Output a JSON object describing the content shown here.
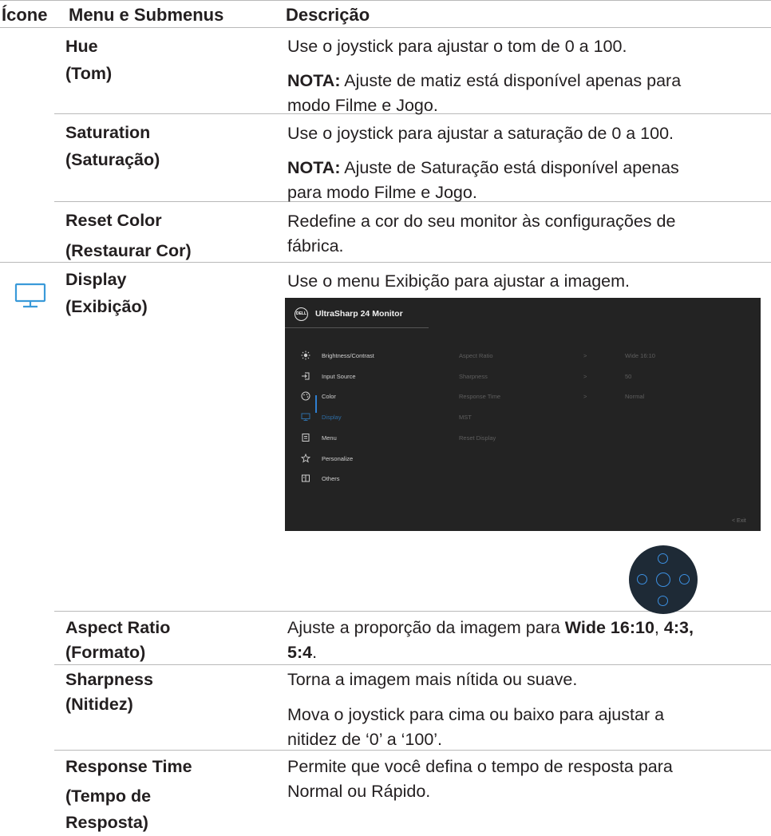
{
  "header": {
    "col_icon": "Ícone",
    "col_menu": "Menu e Submenus",
    "col_desc": "Descrição"
  },
  "rows": {
    "hue": {
      "name": "Hue",
      "sub": "(Tom)",
      "desc1": "Use o joystick para ajustar o tom de 0 a 100.",
      "note_label": "NOTA:",
      "note_line1": " Ajuste de matiz está disponível apenas para",
      "note_line2": "modo Filme e Jogo."
    },
    "saturation": {
      "name": "Saturation",
      "sub": "(Saturação)",
      "desc1": "Use o joystick para ajustar a saturação de 0 a 100.",
      "note_label": "NOTA:",
      "note_line1": " Ajuste de Saturação está disponível apenas",
      "note_line2": "para modo Filme e Jogo."
    },
    "reset_color": {
      "name": "Reset Color",
      "sub": "(Restaurar Cor)",
      "desc_line1": "Redefine a cor do seu monitor às configurações de",
      "desc_line2": "fábrica."
    },
    "display": {
      "name": "Display",
      "sub": "(Exibição)",
      "desc": "Use o menu Exibição para ajustar a imagem.",
      "icon": "monitor-icon"
    },
    "aspect_ratio": {
      "name": "Aspect Ratio",
      "sub": "(Formato)",
      "desc_pre": "Ajuste a proporção da imagem para ",
      "opt1": "Wide 16:10",
      "sep": ", ",
      "opt2": "4:3,",
      "opt3": "5:4",
      "end": "."
    },
    "sharpness": {
      "name": "Sharpness",
      "sub": "(Nitidez)",
      "desc1": "Torna a imagem mais nítida ou suave.",
      "desc2_line1": "Mova o joystick para cima ou baixo para ajustar a",
      "desc2_line2": "nitidez de ‘0’ a ‘100’."
    },
    "response_time": {
      "name": "Response Time",
      "sub1": "(Tempo de",
      "sub2": "Resposta)",
      "desc_line1": "Permite que você defina o tempo de resposta para",
      "desc_line2": "Normal ou Rápido."
    }
  },
  "osd": {
    "logo": "DELL",
    "title": "UltraSharp 24 Monitor",
    "menu_items": [
      {
        "label": "Brightness/Contrast",
        "icon": "brightness-icon"
      },
      {
        "label": "Input Source",
        "icon": "input-source-icon"
      },
      {
        "label": "Color",
        "icon": "color-palette-icon"
      },
      {
        "label": "Display",
        "icon": "display-icon"
      },
      {
        "label": "Menu",
        "icon": "menu-icon"
      },
      {
        "label": "Personalize",
        "icon": "star-icon"
      },
      {
        "label": "Others",
        "icon": "others-icon"
      }
    ],
    "active_item": "Display",
    "sub_items": [
      {
        "label": "Aspect Ratio",
        "arrow": ">",
        "value": "Wide 16:10"
      },
      {
        "label": "Sharpness",
        "arrow": ">",
        "value": "50"
      },
      {
        "label": "Response Time",
        "arrow": ">",
        "value": "Normal"
      },
      {
        "label": "MST",
        "arrow": "",
        "value": ""
      },
      {
        "label": "Reset Display",
        "arrow": "",
        "value": ""
      }
    ],
    "exit": "<  Exit"
  },
  "colors": {
    "accent": "#2f7fd1",
    "rule": "#b9b9b9",
    "osd_bg": "#232323",
    "icon_blue": "#3a9ad9"
  }
}
